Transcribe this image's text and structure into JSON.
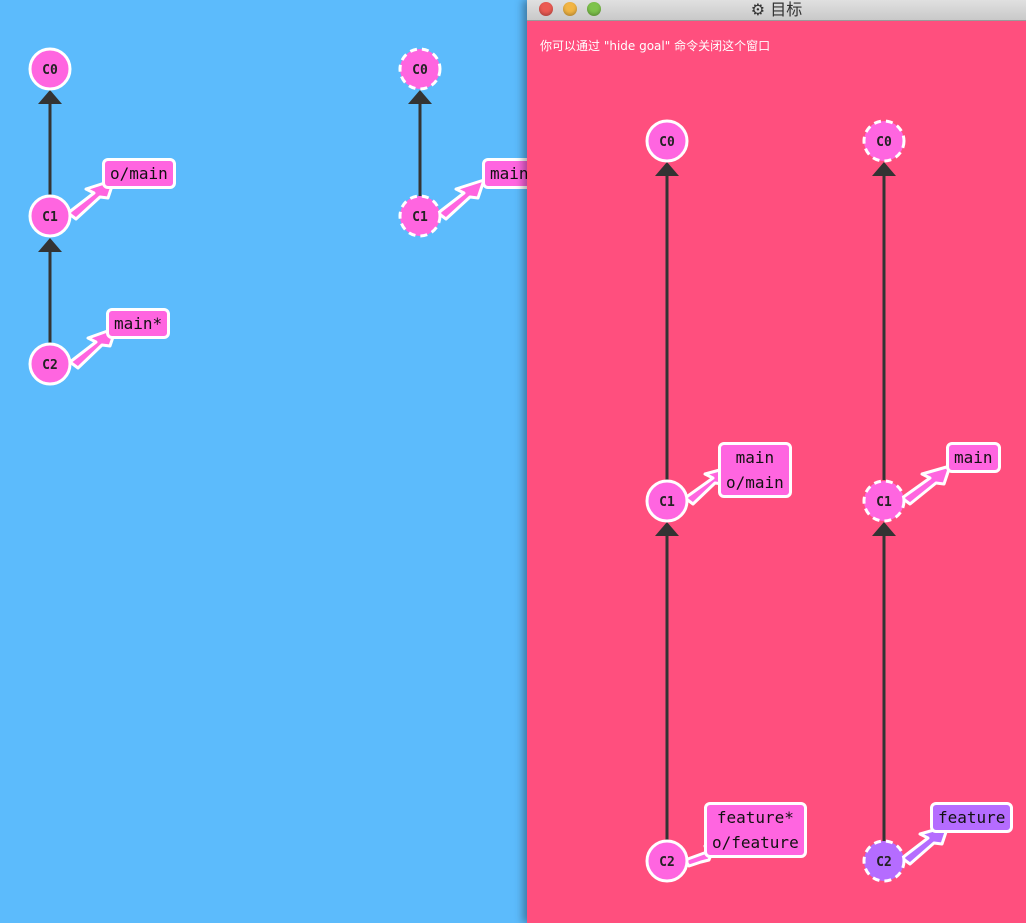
{
  "current_tree": {
    "commits": [
      "C0",
      "C1",
      "C2"
    ],
    "branches": {
      "remote_main": "o/main",
      "local_main": "main*"
    }
  },
  "remote_tree": {
    "commits": [
      "C0",
      "C1"
    ],
    "branches": {
      "main": "main"
    }
  },
  "goal_window": {
    "title": "目标",
    "hint": "你可以通过 \"hide goal\" 命令关闭这个窗口",
    "local_tree": {
      "commits": [
        "C0",
        "C1",
        "C2"
      ],
      "labels": {
        "c1_line1": "main",
        "c1_line2": "o/main",
        "c2_line1": "feature*",
        "c2_line2": "o/feature"
      }
    },
    "remote_tree": {
      "commits": [
        "C0",
        "C1",
        "C2"
      ],
      "labels": {
        "main": "main",
        "feature": "feature"
      }
    }
  },
  "colors": {
    "background": "#5cbbfc",
    "goal_background": "#ff4f7e",
    "commit_pink": "#ff65e0",
    "commit_purple": "#b56cff"
  },
  "icons": {
    "title_icon": "gear-icon",
    "window_buttons": [
      "close-icon",
      "minimize-icon",
      "zoom-icon"
    ]
  }
}
